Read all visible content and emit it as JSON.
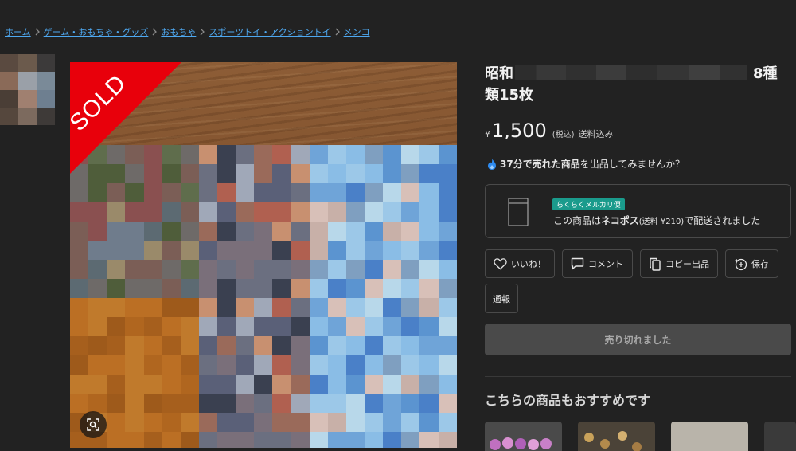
{
  "breadcrumb": {
    "items": [
      {
        "label": "ホーム"
      },
      {
        "label": "ゲーム・おもちゃ・グッズ"
      },
      {
        "label": "おもちゃ"
      },
      {
        "label": "スポーツトイ・アクショントイ"
      },
      {
        "label": "メンコ"
      }
    ]
  },
  "product": {
    "badge": "SOLD",
    "title_start": "昭和",
    "title_end": "8種類15枚",
    "currency_symbol": "¥",
    "price": "1,500",
    "tax_note": "(税込)",
    "shipping_note": "送料込み"
  },
  "promo": {
    "highlight": "37分で売れた商品",
    "rest": "を出品してみませんか？"
  },
  "shipping": {
    "tag": "らくらくメルカリ便",
    "desc_pre": "この商品は",
    "method": "ネコポス",
    "fee": "(送料 ¥210)",
    "desc_post": "で配送されました"
  },
  "actions": {
    "like": "いいね！",
    "comment": "コメント",
    "copy": "コピー出品",
    "save": "保存",
    "report": "通報"
  },
  "sold_out_label": "売り切れました",
  "recommend": {
    "heading": "こちらの商品もおすすめです"
  },
  "colors": {
    "background": "#222222",
    "link": "#4ea8f0",
    "sold_badge": "#e8000b",
    "ship_tag": "#1a9b8c",
    "sold_out_button": "#4a4a4a"
  }
}
